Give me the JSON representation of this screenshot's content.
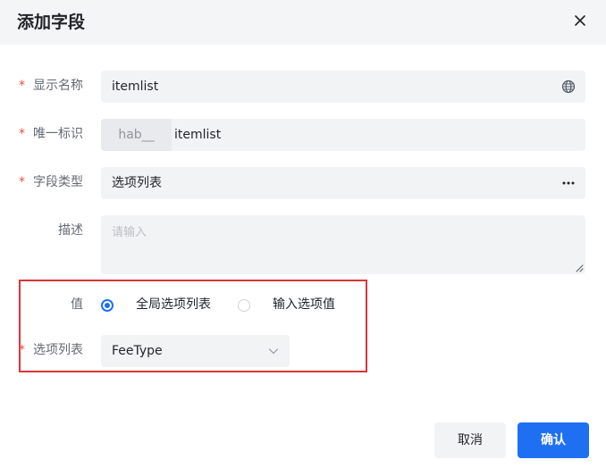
{
  "dialog": {
    "title": "添加字段",
    "close_icon": "close-icon"
  },
  "form": {
    "display_name": {
      "label": "显示名称",
      "required_mark": "*",
      "value": "itemlist",
      "icon": "globe-icon"
    },
    "unique_id": {
      "label": "唯一标识",
      "required_mark": "*",
      "prefix": "hab__",
      "value": "itemlist"
    },
    "field_type": {
      "label": "字段类型",
      "required_mark": "*",
      "value": "选项列表",
      "icon": "more-icon"
    },
    "description": {
      "label": "描述",
      "placeholder": "请输入"
    },
    "value_source": {
      "label": "值",
      "options": [
        {
          "label": "全局选项列表",
          "checked": true
        },
        {
          "label": "输入选项值",
          "checked": false
        }
      ]
    },
    "option_list": {
      "label": "选项列表",
      "required_mark": "*",
      "value": "FeeType",
      "icon": "chevron-down-icon"
    }
  },
  "footer": {
    "cancel_label": "取消",
    "confirm_label": "确认"
  },
  "colors": {
    "primary": "#1f6ff2",
    "required": "#f54a45",
    "highlight_border": "#d9363e"
  }
}
